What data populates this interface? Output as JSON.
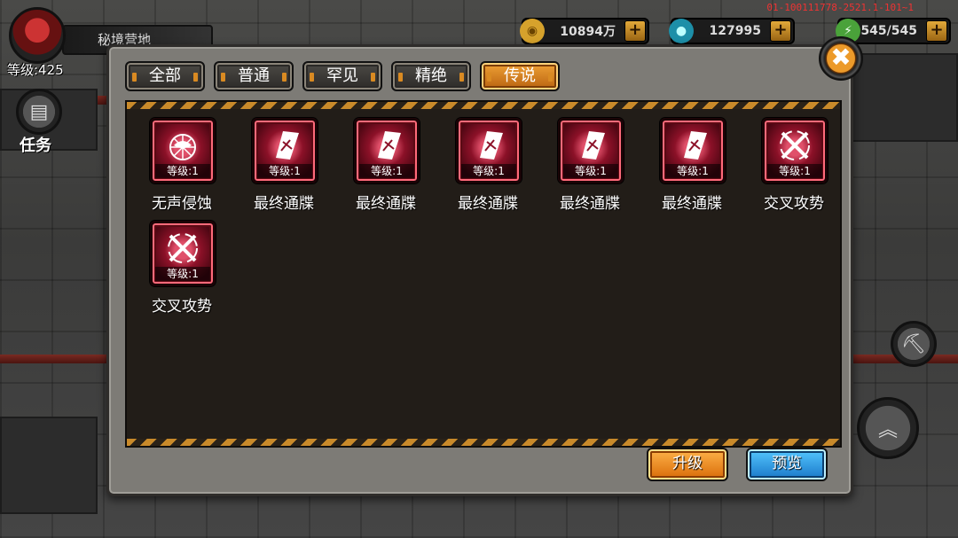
{
  "hud": {
    "map_name": "秘境营地",
    "level_label": "等级:425",
    "build_id": "01-100111778-2521.1-101~1",
    "resources": [
      {
        "icon": "gold-coin-icon",
        "glyph": "◉",
        "value": "10894万",
        "plus": "+"
      },
      {
        "icon": "gem-icon",
        "glyph": "●",
        "value": "127995",
        "plus": "+"
      },
      {
        "icon": "stamina-icon",
        "glyph": "⚡",
        "value": "545/545",
        "plus": "+"
      }
    ],
    "side_labels": {
      "quest": "任务"
    }
  },
  "panel": {
    "close_glyph": "✖",
    "tabs": [
      {
        "label": "全部",
        "active": false
      },
      {
        "label": "普通",
        "active": false
      },
      {
        "label": "罕见",
        "active": false
      },
      {
        "label": "精绝",
        "active": false
      },
      {
        "label": "传说",
        "active": true
      }
    ],
    "cards": [
      {
        "name": "无声侵蚀",
        "level": "等级:1",
        "icon": "web-bat-icon"
      },
      {
        "name": "最终通牒",
        "level": "等级:1",
        "icon": "ultimatum-card-icon"
      },
      {
        "name": "最终通牒",
        "level": "等级:1",
        "icon": "ultimatum-card-icon"
      },
      {
        "name": "最终通牒",
        "level": "等级:1",
        "icon": "ultimatum-card-icon"
      },
      {
        "name": "最终通牒",
        "level": "等级:1",
        "icon": "ultimatum-card-icon"
      },
      {
        "name": "最终通牒",
        "level": "等级:1",
        "icon": "ultimatum-card-icon"
      },
      {
        "name": "交叉攻势",
        "level": "等级:1",
        "icon": "crossed-blades-icon"
      },
      {
        "name": "交叉攻势",
        "level": "等级:1",
        "icon": "crossed-blades-icon"
      }
    ],
    "buttons": {
      "upgrade": "升级",
      "preview": "预览"
    }
  },
  "colors": {
    "accent_orange": "#e58a1c",
    "accent_blue": "#2a98e2",
    "legendary_red": "#8c1128",
    "panel_dark": "#221d18"
  }
}
